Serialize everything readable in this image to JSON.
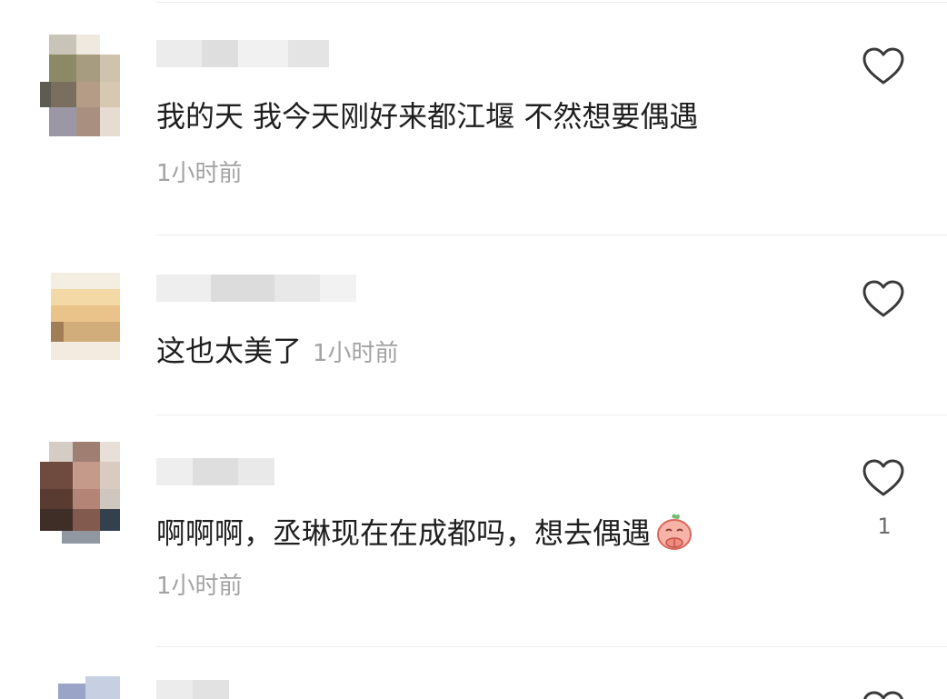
{
  "comments": [
    {
      "text": "我的天 我今天刚好来都江堰 不然想要偶遇",
      "time": "1小时前",
      "like_icon": "heart-outline-icon"
    },
    {
      "text": "这也太美了",
      "time": "1小时前",
      "like_icon": "heart-outline-icon"
    },
    {
      "text": "啊啊啊，丞琳现在在成都吗，想去偶遇",
      "time": "1小时前",
      "like_icon": "heart-outline-icon",
      "like_count": "1",
      "emoji": "praying-emoji-icon"
    }
  ],
  "colors": {
    "text": "#1f1f1f",
    "meta": "#a3a3a3",
    "icon": "#3a3a3a",
    "divider": "#ececec"
  }
}
